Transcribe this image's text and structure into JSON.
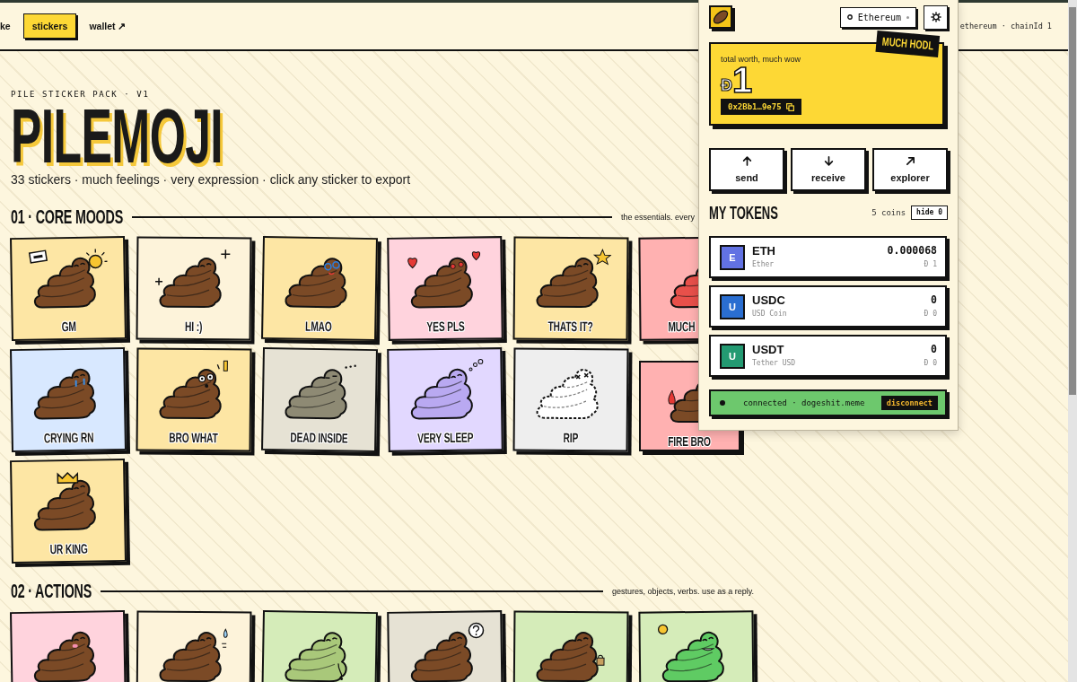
{
  "nav": {
    "links": [
      {
        "label": "ke",
        "selected": false
      },
      {
        "label": "stickers",
        "selected": true
      },
      {
        "label": "wallet ↗",
        "selected": false
      }
    ],
    "network_info": "ethereum · chainId 1"
  },
  "hero": {
    "eyebrow": "PILE STICKER PACK · V1",
    "title": "PILEMOJI",
    "subtitle": "33 stickers · much feelings · very expression · click any sticker to export"
  },
  "sections": [
    {
      "heading": "01 · CORE MOODS",
      "note": "the essentials. every",
      "stickers": [
        {
          "label": "GM",
          "kind": "sun",
          "color": "#fde6a4"
        },
        {
          "label": "HI :)",
          "kind": "sparkle",
          "color": "#fdf3da"
        },
        {
          "label": "LMAO",
          "kind": "glasses",
          "color": "#fde6a4"
        },
        {
          "label": "YES PLS",
          "kind": "hearts",
          "color": "#ffd3dd"
        },
        {
          "label": "THATS IT?",
          "kind": "star",
          "color": "#fde6a4"
        },
        {
          "label": "MUCH",
          "kind": "angry",
          "color": "#ffb1b1"
        },
        {
          "label": "CRYING RN",
          "kind": "tears",
          "color": "#d8e8ff"
        },
        {
          "label": "BRO WHAT",
          "kind": "shock",
          "color": "#fde6a4"
        },
        {
          "label": "DEAD INSIDE",
          "kind": "dead",
          "color": "#e6e2d4"
        },
        {
          "label": "VERY SLEEP",
          "kind": "sleep",
          "color": "#e2d8ff"
        },
        {
          "label": "RIP",
          "kind": "ghost",
          "color": "#eeeeee"
        },
        {
          "label": "FIRE BRO",
          "kind": "fire",
          "color": "#ffb1b1"
        },
        {
          "label": "UR KING",
          "kind": "crown",
          "color": "#fde6a4"
        }
      ]
    },
    {
      "heading": "02 · ACTIONS",
      "note": "gestures, objects, verbs. use as a reply.",
      "stickers": [
        {
          "kind": "blush",
          "color": "#ffd3dd"
        },
        {
          "kind": "sweat",
          "color": "#fdf3da"
        },
        {
          "kind": "sick",
          "color": "#d5ecb9"
        },
        {
          "kind": "question",
          "color": "#e6e2d4"
        },
        {
          "kind": "bag",
          "color": "#d5ecb9"
        },
        {
          "kind": "rich",
          "color": "#d5ecb9"
        }
      ]
    }
  ],
  "wallet": {
    "network": "Ethereum",
    "balance": {
      "tag": "MUCH HODL",
      "caption": "total worth, much wow",
      "symbol": "Ð",
      "amount": "1",
      "address": "0x2Bb1…9e75"
    },
    "actions": [
      {
        "kind": "send",
        "label": "send"
      },
      {
        "kind": "receive",
        "label": "receive"
      },
      {
        "kind": "explorer",
        "label": "explorer"
      }
    ],
    "tokens_title": "MY TOKENS",
    "coin_count": "5 coins",
    "hide_label": "hide 0",
    "tokens": [
      {
        "letter": "E",
        "color": "#6272e3",
        "symbol": "ETH",
        "name": "Ether",
        "amount": "0.000068",
        "value": "Ð 1"
      },
      {
        "letter": "U",
        "color": "#2a6ed1",
        "symbol": "USDC",
        "name": "USD Coin",
        "amount": "0",
        "value": "Ð 0"
      },
      {
        "letter": "U",
        "color": "#239a72",
        "symbol": "USDT",
        "name": "Tether USD",
        "amount": "0",
        "value": "Ð 0"
      }
    ],
    "status": {
      "text": "connected · dogeshit.meme",
      "button": "disconnect"
    }
  }
}
